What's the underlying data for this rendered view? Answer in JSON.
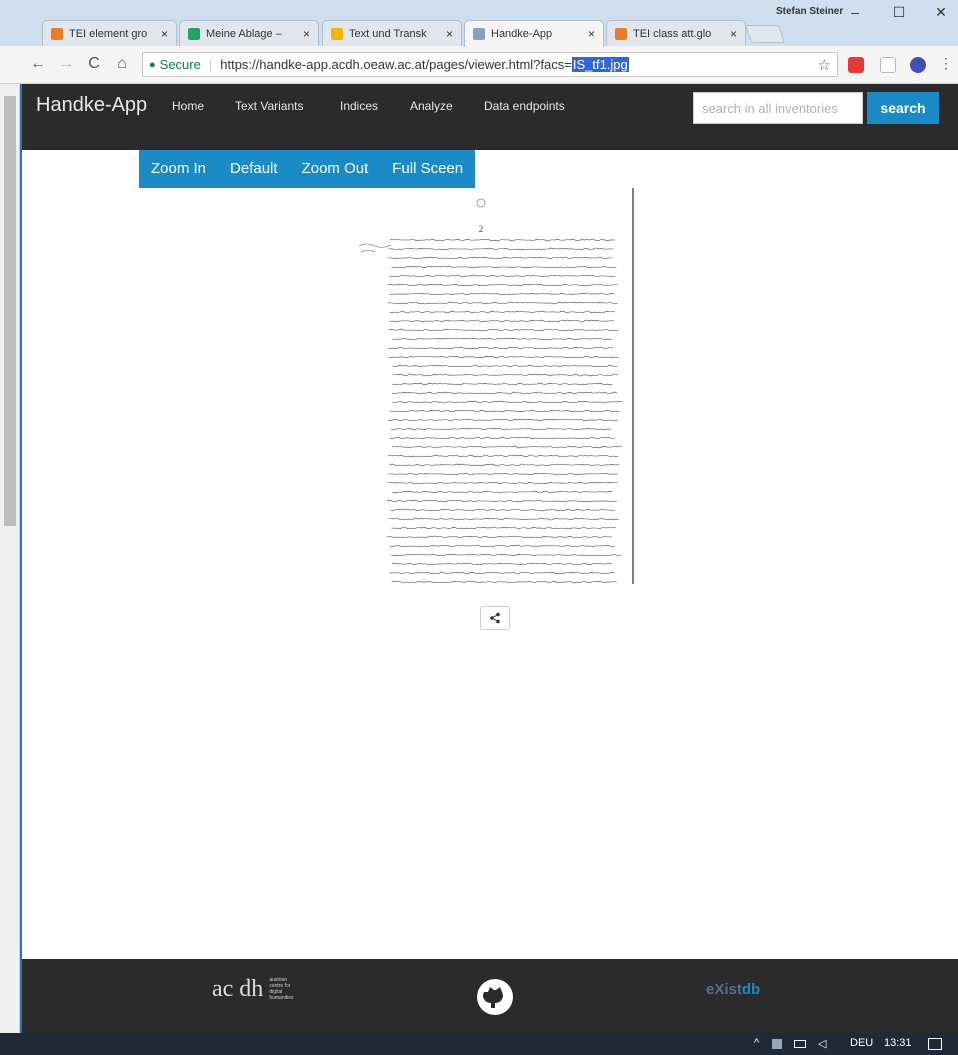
{
  "browser": {
    "tabs": [
      {
        "title": "TEI element gro",
        "active": false,
        "favicon_color": "#e97e2a"
      },
      {
        "title": "Meine Ablage –",
        "active": false,
        "favicon_color": "#1fa463"
      },
      {
        "title": "Text und Transk",
        "active": false,
        "favicon_color": "#f4b400"
      },
      {
        "title": "Handke-App",
        "active": true,
        "favicon_color": "#8aa1b9"
      },
      {
        "title": "TEI class att.glo",
        "active": false,
        "favicon_color": "#e97e2a"
      }
    ],
    "profile_name": "Stefan Steiner",
    "window_controls": {
      "minimize": "–",
      "maximize": "☐",
      "close": "✕"
    },
    "nav": {
      "back": "←",
      "forward": "→",
      "reload": "C",
      "home": "⌂"
    },
    "address": {
      "secure_label": "Secure",
      "url_base": "https://handke-app.acdh.oeaw.ac.at/pages/viewer.html?facs=",
      "url_selected": "IS_tf1.jpg"
    },
    "icons": {
      "star": "star-icon",
      "ext1": "red-extension-icon",
      "ext2": "document-extension-icon",
      "ext3": "colorful-extension-icon",
      "menu": "kebab-menu-icon"
    },
    "ext_colors": {
      "ext1": "#e53935",
      "ext2": "#cfd8dc",
      "ext3": "#3f51b5"
    }
  },
  "app": {
    "brand": "Handke-App",
    "nav_items": [
      "Home",
      "Text Variants",
      "Indices",
      "Analyze",
      "Data endpoints"
    ],
    "search": {
      "placeholder": "search in all inventories",
      "button": "search"
    },
    "viewer_buttons": [
      "Zoom In",
      "Default",
      "Zoom Out",
      "Full Sceen"
    ],
    "page_number": "2",
    "share_icon": "share-icon",
    "accent_color": "#1a8bc7",
    "nav_bg": "#2b2b2b"
  },
  "footer": {
    "acdh_mark": "ac dh",
    "acdh_lines": [
      "austrian",
      "centre for",
      "digital",
      "humanities"
    ],
    "github_icon": "github-icon",
    "existdb_prefix": "eXist",
    "existdb_suffix": "db"
  },
  "taskbar": {
    "lang": "DEU",
    "time": "13:31",
    "icons": [
      "chevron-up-icon",
      "network-icon",
      "battery-icon",
      "speaker-icon",
      "notification-icon"
    ]
  }
}
